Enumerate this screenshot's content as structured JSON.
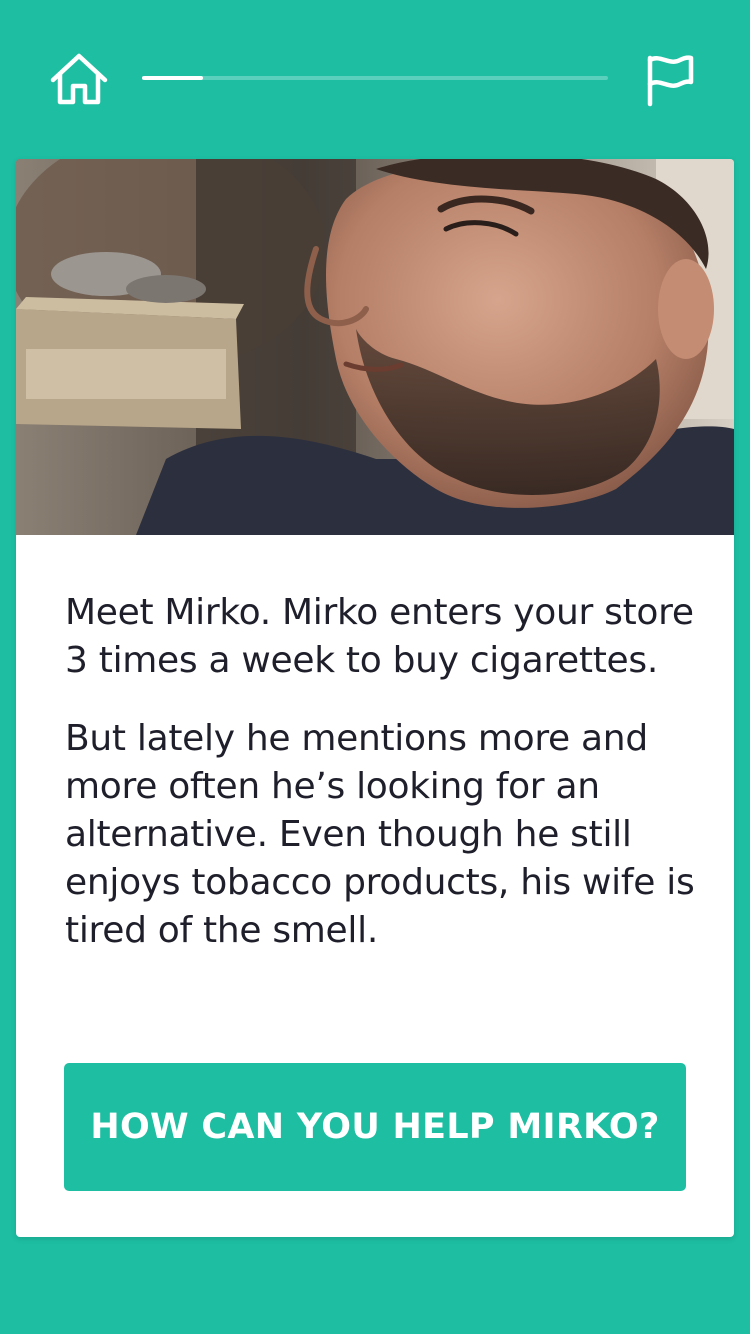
{
  "header": {
    "home_icon": "home-icon",
    "flag_icon": "flag-icon",
    "progress": 0.13
  },
  "card": {
    "photo_description_icon": "photo",
    "paragraphs": [
      "Meet Mirko. Mirko enters your store 3 times a week to buy cigarettes.",
      "But lately he mentions more and more often he’s looking for an alternative. Even though he still enjoys tobacco products, his wife is tired of the smell."
    ],
    "cta_label": "HOW CAN YOU HELP MIRKO?"
  },
  "colors": {
    "accent": "#1dbea2",
    "text": "#1f1f2b",
    "card": "#ffffff"
  }
}
